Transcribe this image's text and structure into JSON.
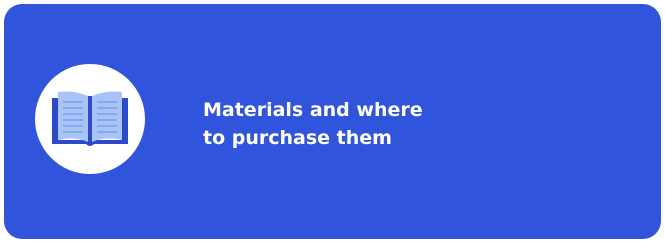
{
  "card": {
    "title": "Materials and where\nto purchase them",
    "icon": "open-book-icon",
    "colors": {
      "background": "#3154dc",
      "icon_circle": "#ffffff",
      "book_pages": "#a9c3f6",
      "book_cover": "#2b49c8",
      "book_lines": "#7f9ff0",
      "title_text": "#ffffff"
    }
  }
}
